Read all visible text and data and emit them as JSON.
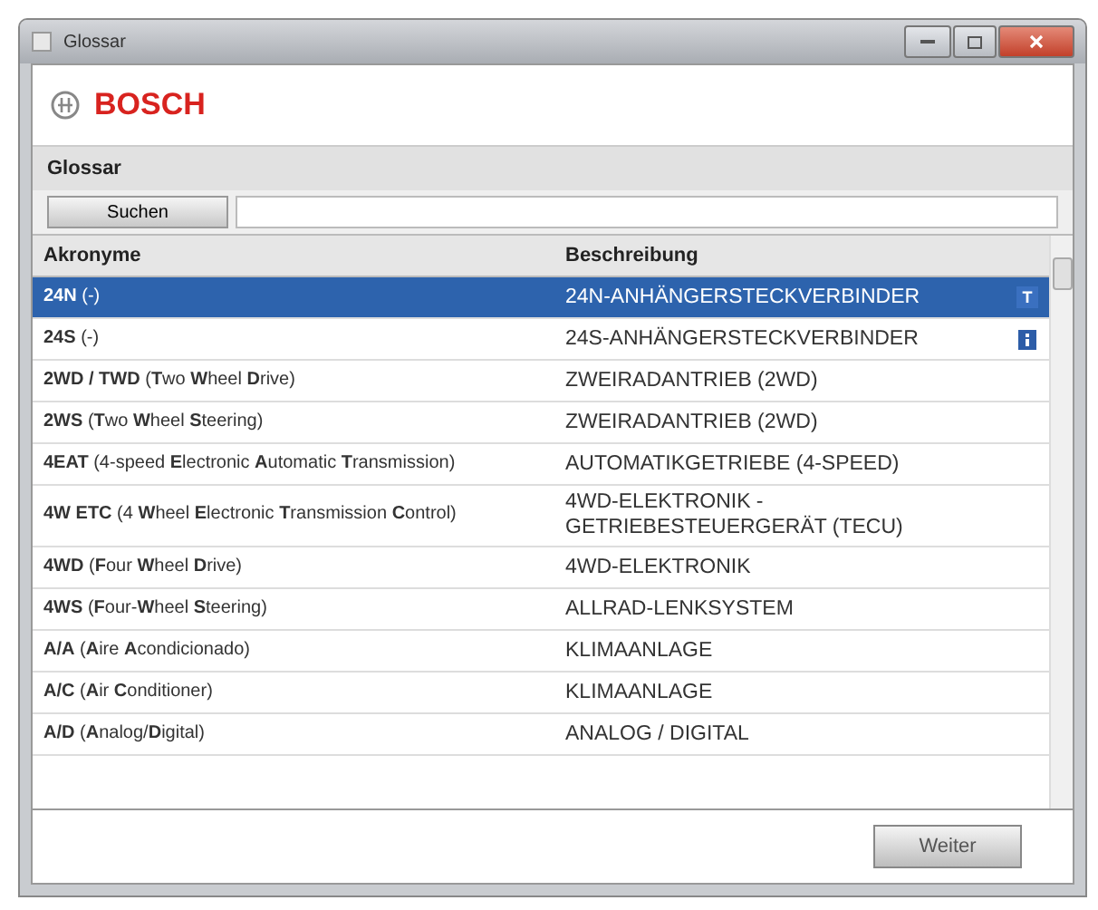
{
  "window": {
    "title": "Glossar"
  },
  "brand": {
    "name": "BOSCH"
  },
  "section": {
    "title": "Glossar"
  },
  "search": {
    "button": "Suchen"
  },
  "table": {
    "columns": [
      "Akronyme",
      "Beschreibung"
    ],
    "rows": [
      {
        "acronym": "**24N** (-)",
        "description": "24N-ANHÄNGERSTECKVERBINDER",
        "selected": true,
        "marker": {
          "kind": "text",
          "text": "T"
        }
      },
      {
        "acronym": "**24S** (-)",
        "description": "24S-ANHÄNGERSTECKVERBINDER",
        "selected": false,
        "marker": {
          "kind": "info"
        }
      },
      {
        "acronym": "**2WD / TWD** (**T**wo **W**heel **D**rive)",
        "description": "ZWEIRADANTRIEB (2WD)",
        "selected": false
      },
      {
        "acronym": "**2WS** (**T**wo **W**heel **S**teering)",
        "description": "ZWEIRADANTRIEB (2WD)",
        "selected": false
      },
      {
        "acronym": "**4EAT** (4-speed **E**lectronic **A**utomatic **T**ransmission)",
        "description": "AUTOMATIKGETRIEBE (4-SPEED)",
        "selected": false
      },
      {
        "acronym": "**4W ETC** (4 **W**heel **E**lectronic **T**ransmission **C**ontrol)",
        "description": "4WD-ELEKTRONIK - GETRIEBESTEUERGERÄT (TECU)",
        "selected": false
      },
      {
        "acronym": "**4WD** (**F**our **W**heel **D**rive)",
        "description": "4WD-ELEKTRONIK",
        "selected": false
      },
      {
        "acronym": "**4WS** (**F**our-**W**heel **S**teering)",
        "description": "ALLRAD-LENKSYSTEM",
        "selected": false
      },
      {
        "acronym": "**A/A** (**A**ire **A**condicionado)",
        "description": "KLIMAANLAGE",
        "selected": false
      },
      {
        "acronym": "**A/C** (**A**ir **C**onditioner)",
        "description": "KLIMAANLAGE",
        "selected": false
      },
      {
        "acronym": "**A/D** (**A**nalog/**D**igital)",
        "description": "ANALOG / DIGITAL",
        "selected": false
      }
    ]
  },
  "footer": {
    "button": "Weiter"
  }
}
